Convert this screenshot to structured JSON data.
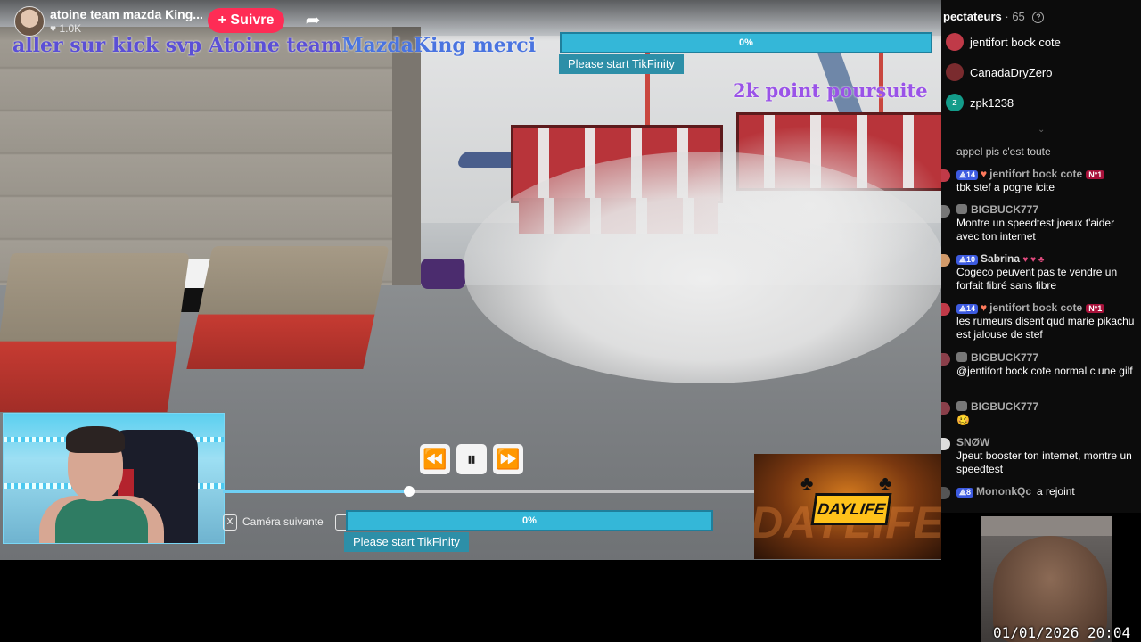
{
  "stream": {
    "streamer_name": "atoine team mazda King...",
    "likes": "1.0K",
    "follow_label": "+ Suivre"
  },
  "overlay": {
    "banner_text_1": "aller sur kick svp Atoine team",
    "banner_text_2": "MazdaKing merci",
    "goal_text": "2k point poursuite",
    "tikfinity_top": {
      "percent": "0%",
      "progress": 0,
      "label": "Please start TikFinity"
    },
    "tikfinity_bottom": {
      "percent": "0%",
      "progress": 0,
      "label": "Please start TikFinity"
    },
    "camera_next": {
      "key": "X",
      "label": "Caméra suivante"
    },
    "sponsor_logo": "DAYLIFE",
    "sponsor_bg_word": "DAYLIFE"
  },
  "playback": {
    "position": 0.35
  },
  "viewers": {
    "label": "pectateurs",
    "count": "65",
    "list": [
      {
        "name": "jentifort bock cote",
        "color": "#c03a48"
      },
      {
        "name": "CanadaDryZero",
        "color": "#7a2b2e"
      },
      {
        "name": "zpk1238",
        "initial": "z",
        "color": "#139c8a"
      }
    ]
  },
  "chat": [
    {
      "user": "",
      "text": "appel pis c'est toute"
    },
    {
      "user": "jentifort bock cote",
      "level": "14",
      "rank": "N°1",
      "text": "tbk stef a pogne icite"
    },
    {
      "user": "BIGBUCK777",
      "text": "Montre un speedtest joeux t'aider avec ton internet"
    },
    {
      "user": "Sabrina",
      "level": "10",
      "badges": "♥ ♥ ♣",
      "text": "Cogeco peuvent pas te vendre un forfait fibré sans fibre"
    },
    {
      "user": "jentifort bock cote",
      "level": "14",
      "rank": "N°1",
      "text": "les rumeurs disent qud marie pikachu est jalouse de stef"
    },
    {
      "user": "BIGBUCK777",
      "text": "@jentifort bock cote normal c une gilf"
    },
    {
      "user": "BIGBUCK777",
      "text": "🥴"
    },
    {
      "user": "SNØW",
      "text": "Jpeut booster ton internet, montre un speedtest"
    },
    {
      "user": "MononkQc",
      "level": "8",
      "inline": "a rejoint"
    }
  ],
  "clock": {
    "date": "01/01/2026",
    "time": "20:04"
  }
}
